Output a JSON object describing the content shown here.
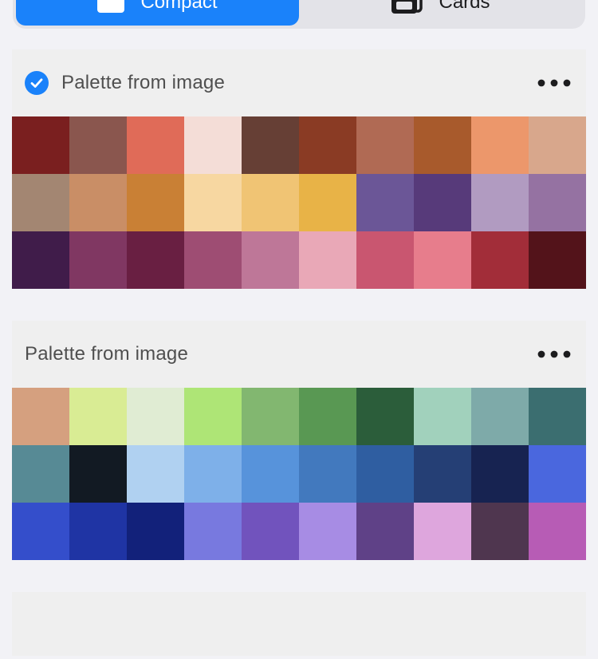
{
  "view_toggle": {
    "options": [
      {
        "label": "Compact",
        "icon": "compact-view-icon",
        "active": true
      },
      {
        "label": "Cards",
        "icon": "cards-view-icon",
        "active": false
      }
    ]
  },
  "palettes": [
    {
      "title": "Palette from image",
      "selected": true,
      "more_icon": "more-horizontal-icon",
      "colors": [
        "#7a1f1f",
        "#8a564e",
        "#e06b58",
        "#f4ddd7",
        "#663f35",
        "#8a3b24",
        "#b06a54",
        "#a85a2c",
        "#ec976b",
        "#d8a78c",
        "#a38672",
        "#c98e66",
        "#c98035",
        "#f7d7a1",
        "#f0c474",
        "#e8b347",
        "#6b5697",
        "#573a7a",
        "#b19bc1",
        "#9572a2",
        "#401c4a",
        "#803762",
        "#691f42",
        "#9e4d73",
        "#be7798",
        "#e9a8b7",
        "#c95670",
        "#e77d8c",
        "#a22d39",
        "#53131a"
      ]
    },
    {
      "title": "Palette from image",
      "selected": false,
      "more_icon": "more-horizontal-icon",
      "colors": [
        "#d5a07f",
        "#d9ec94",
        "#e0ecd3",
        "#aee576",
        "#82b770",
        "#599853",
        "#2b5d3a",
        "#a1d1bc",
        "#7eaaa9",
        "#3b6e70",
        "#578a95",
        "#121a23",
        "#b0d1f1",
        "#7eb0e9",
        "#5793db",
        "#4279be",
        "#2f5ea1",
        "#253f75",
        "#172351",
        "#4a67de",
        "#344ecb",
        "#1f34a4",
        "#12217a",
        "#7879df",
        "#7153bd",
        "#a78ce4",
        "#5f4187",
        "#dea6dd",
        "#4f364f",
        "#b75cb5"
      ]
    },
    {
      "title": "",
      "selected": false,
      "more_icon": "",
      "colors": []
    }
  ]
}
